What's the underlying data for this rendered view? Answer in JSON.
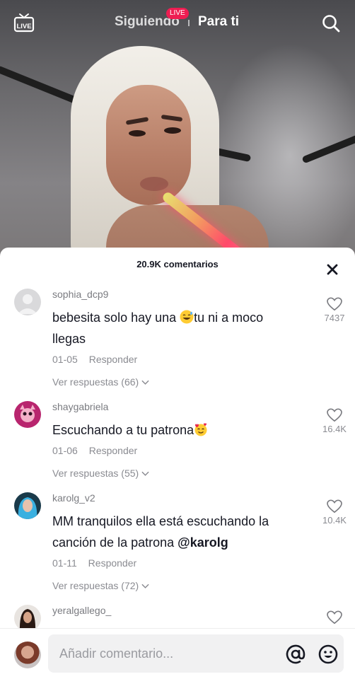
{
  "topbar": {
    "live_icon_label": "LIVE",
    "live_badge": "LIVE",
    "tab_following": "Siguiendo",
    "tab_foryou": "Para ti",
    "icons": [
      "live-icon",
      "search-icon"
    ]
  },
  "comments_panel": {
    "title": "20.9K comentarios",
    "comments": [
      {
        "username": "sophia_dcp9",
        "text_before": "bebesita solo hay una ",
        "emoji": "grinning-sweat-emoji",
        "text_after": "tu ni a moco llegas",
        "date": "01-05",
        "reply_label": "Responder",
        "replies_label": "Ver respuestas (66)",
        "likes": "7437"
      },
      {
        "username": "shaygabriela",
        "text_before": "Escuchando a tu patrona",
        "emoji": "smiling-hearts-emoji",
        "text_after": "",
        "date": "01-06",
        "reply_label": "Responder",
        "replies_label": "Ver respuestas (55)",
        "likes": "16.4K"
      },
      {
        "username": "karolg_v2",
        "text_before": "MM tranquilos ella está escuchando la canción de la patrona ",
        "mention": "@karolg",
        "date": "01-11",
        "reply_label": "Responder",
        "replies_label": "Ver respuestas (72)",
        "likes": "10.4K"
      },
      {
        "username": "yeralgallego_"
      }
    ]
  },
  "input": {
    "placeholder": "Añadir comentario..."
  },
  "colors": {
    "live_badge": "#ee1d52",
    "text_primary": "#161823",
    "text_secondary": "#8a8b91",
    "input_bg": "#f1f1f2"
  }
}
